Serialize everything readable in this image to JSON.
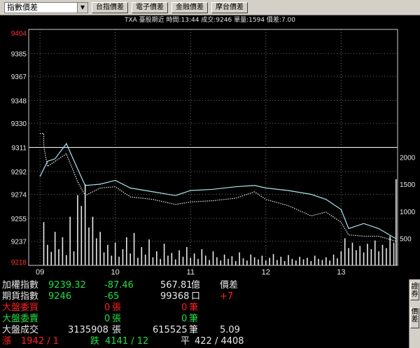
{
  "toolbar": {
    "selector": "指數價差",
    "buttons": [
      "台指價差",
      "電子價差",
      "金融價差",
      "摩台價差"
    ]
  },
  "info_line": "TXA  臺股期近 時間:13:44 成交:9246 單量:1594 價差:7.00",
  "chart_data": {
    "type": "line",
    "y_ticks": [
      "9404",
      "9385",
      "9367",
      "9348",
      "9330",
      "9311",
      "9292",
      "9274",
      "9255",
      "9237",
      "9218"
    ],
    "ylim": [
      9218,
      9404
    ],
    "volume_ticks": [
      "2000",
      "1500",
      "1000",
      "500"
    ],
    "volume_lim": [
      0,
      2400
    ],
    "x_ticks": [
      "09",
      "10",
      "11",
      "12",
      "13"
    ],
    "reference_price": 9311,
    "series": [
      {
        "color": "#a8e6ee",
        "x": [
          9.0,
          9.1,
          9.2,
          9.35,
          9.5,
          9.6,
          9.8,
          10.0,
          10.2,
          10.5,
          10.8,
          11.0,
          11.3,
          11.6,
          11.85,
          12.0,
          12.3,
          12.6,
          12.8,
          13.0,
          13.1,
          13.3,
          13.5,
          13.73
        ],
        "values": [
          9288,
          9300,
          9302,
          9314,
          9294,
          9281,
          9282,
          9285,
          9279,
          9276,
          9273,
          9277,
          9278,
          9280,
          9281,
          9279,
          9277,
          9274,
          9270,
          9262,
          9247,
          9251,
          9247,
          9239
        ]
      },
      {
        "color": "#e8e8e8",
        "x": [
          9.0,
          9.05,
          9.05,
          9.1,
          9.2,
          9.35,
          9.5,
          9.6,
          9.8,
          10.0,
          10.2,
          10.5,
          10.8,
          11.0,
          11.3,
          11.6,
          11.85,
          12.0,
          12.3,
          12.6,
          12.8,
          13.0,
          13.1,
          13.3,
          13.5,
          13.73
        ],
        "values": [
          9322,
          9322,
          9312,
          9296,
          9300,
          9306,
          9284,
          9273,
          9279,
          9280,
          9272,
          9270,
          9266,
          9268,
          9269,
          9271,
          9276,
          9270,
          9265,
          9257,
          9260,
          9252,
          9242,
          9241,
          9241,
          9237
        ]
      }
    ],
    "volume_bars": [
      {
        "x": 9.05,
        "v": 800
      },
      {
        "x": 9.1,
        "v": 380
      },
      {
        "x": 9.15,
        "v": 250
      },
      {
        "x": 9.2,
        "v": 620
      },
      {
        "x": 9.25,
        "v": 300
      },
      {
        "x": 9.3,
        "v": 520
      },
      {
        "x": 9.35,
        "v": 190
      },
      {
        "x": 9.4,
        "v": 900
      },
      {
        "x": 9.45,
        "v": 260
      },
      {
        "x": 9.5,
        "v": 1300
      },
      {
        "x": 9.55,
        "v": 1100
      },
      {
        "x": 9.6,
        "v": 1500
      },
      {
        "x": 9.65,
        "v": 700
      },
      {
        "x": 9.7,
        "v": 900
      },
      {
        "x": 9.75,
        "v": 500
      },
      {
        "x": 9.8,
        "v": 620
      },
      {
        "x": 9.85,
        "v": 240
      },
      {
        "x": 9.9,
        "v": 380
      },
      {
        "x": 9.95,
        "v": 180
      },
      {
        "x": 10.0,
        "v": 420
      },
      {
        "x": 10.05,
        "v": 160
      },
      {
        "x": 10.1,
        "v": 300
      },
      {
        "x": 10.15,
        "v": 520
      },
      {
        "x": 10.2,
        "v": 220
      },
      {
        "x": 10.25,
        "v": 600
      },
      {
        "x": 10.3,
        "v": 140
      },
      {
        "x": 10.35,
        "v": 340
      },
      {
        "x": 10.4,
        "v": 200
      },
      {
        "x": 10.45,
        "v": 480
      },
      {
        "x": 10.5,
        "v": 150
      },
      {
        "x": 10.55,
        "v": 260
      },
      {
        "x": 10.6,
        "v": 120
      },
      {
        "x": 10.65,
        "v": 400
      },
      {
        "x": 10.7,
        "v": 180
      },
      {
        "x": 10.75,
        "v": 230
      },
      {
        "x": 10.8,
        "v": 110
      },
      {
        "x": 10.85,
        "v": 280
      },
      {
        "x": 10.9,
        "v": 160
      },
      {
        "x": 10.95,
        "v": 340
      },
      {
        "x": 11.0,
        "v": 140
      },
      {
        "x": 11.05,
        "v": 220
      },
      {
        "x": 11.1,
        "v": 120
      },
      {
        "x": 11.15,
        "v": 300
      },
      {
        "x": 11.2,
        "v": 180
      },
      {
        "x": 11.25,
        "v": 100
      },
      {
        "x": 11.3,
        "v": 260
      },
      {
        "x": 11.35,
        "v": 150
      },
      {
        "x": 11.4,
        "v": 90
      },
      {
        "x": 11.45,
        "v": 200
      },
      {
        "x": 11.5,
        "v": 120
      },
      {
        "x": 11.55,
        "v": 170
      },
      {
        "x": 11.6,
        "v": 80
      },
      {
        "x": 11.65,
        "v": 240
      },
      {
        "x": 11.7,
        "v": 130
      },
      {
        "x": 11.75,
        "v": 90
      },
      {
        "x": 11.8,
        "v": 200
      },
      {
        "x": 11.85,
        "v": 150
      },
      {
        "x": 11.9,
        "v": 110
      },
      {
        "x": 11.95,
        "v": 180
      },
      {
        "x": 12.0,
        "v": 90
      },
      {
        "x": 12.05,
        "v": 140
      },
      {
        "x": 12.1,
        "v": 210
      },
      {
        "x": 12.15,
        "v": 100
      },
      {
        "x": 12.2,
        "v": 160
      },
      {
        "x": 12.25,
        "v": 80
      },
      {
        "x": 12.3,
        "v": 190
      },
      {
        "x": 12.35,
        "v": 120
      },
      {
        "x": 12.4,
        "v": 90
      },
      {
        "x": 12.45,
        "v": 160
      },
      {
        "x": 12.5,
        "v": 110
      },
      {
        "x": 12.55,
        "v": 140
      },
      {
        "x": 12.6,
        "v": 80
      },
      {
        "x": 12.65,
        "v": 180
      },
      {
        "x": 12.7,
        "v": 120
      },
      {
        "x": 12.75,
        "v": 100
      },
      {
        "x": 12.8,
        "v": 150
      },
      {
        "x": 12.85,
        "v": 90
      },
      {
        "x": 12.9,
        "v": 200
      },
      {
        "x": 12.95,
        "v": 130
      },
      {
        "x": 13.0,
        "v": 260
      },
      {
        "x": 13.05,
        "v": 500
      },
      {
        "x": 13.1,
        "v": 320
      },
      {
        "x": 13.15,
        "v": 420
      },
      {
        "x": 13.2,
        "v": 280
      },
      {
        "x": 13.25,
        "v": 360
      },
      {
        "x": 13.3,
        "v": 240
      },
      {
        "x": 13.35,
        "v": 400
      },
      {
        "x": 13.4,
        "v": 300
      },
      {
        "x": 13.45,
        "v": 460
      },
      {
        "x": 13.5,
        "v": 260
      },
      {
        "x": 13.55,
        "v": 380
      },
      {
        "x": 13.6,
        "v": 320
      },
      {
        "x": 13.65,
        "v": 540
      },
      {
        "x": 13.7,
        "v": 420
      },
      {
        "x": 13.73,
        "v": 1594
      }
    ]
  },
  "quotes": {
    "r1": {
      "label": "加權指數",
      "price": "9239.32",
      "change": "-87.46",
      "amount": "567.81",
      "unit": "億",
      "tag": "價差"
    },
    "r2": {
      "label": "期貨指數",
      "price": "9246",
      "change": "-65",
      "amount": "99368",
      "unit": "口",
      "tag": "+7"
    },
    "r3": {
      "label": "大盤委買",
      "count": "0",
      "unit1": "張",
      "count2": "0",
      "unit2": "筆"
    },
    "r4": {
      "label": "大盤委賣",
      "count": "0",
      "unit1": "張",
      "count2": "0",
      "unit2": "筆"
    },
    "r5": {
      "label": "大盤成交",
      "count": "3135908",
      "unit1": "張",
      "count2": "615525",
      "unit2": "筆",
      "ratio": "5.09"
    },
    "r6": {
      "up_label": "漲",
      "up": "1942 / 1",
      "down_label": "跌",
      "down": "4141 / 12",
      "flat_label": "平",
      "flat": "422 / 4408"
    }
  },
  "side_tabs": [
    "證券",
    "價差"
  ],
  "colors": {
    "index_line": "#a8e6ee",
    "futures_line": "#e8e8e8",
    "volume": "#e8e8e8",
    "up": "#ff2020",
    "down": "#20e040",
    "text": "#e8e8e8"
  }
}
